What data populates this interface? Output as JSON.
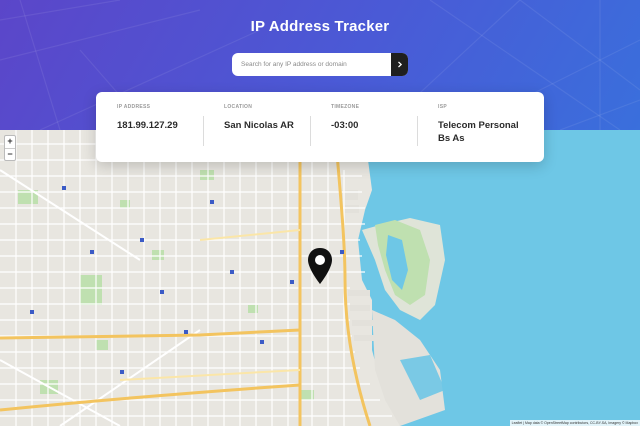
{
  "app": {
    "title": "IP Address Tracker"
  },
  "search": {
    "placeholder": "Search for any IP address or domain",
    "value": "",
    "button_icon": "chevron-right-icon"
  },
  "info": {
    "ip_label": "IP ADDRESS",
    "ip_value": "181.99.127.29",
    "location_label": "LOCATION",
    "location_value": "San Nicolas AR",
    "timezone_label": "TIMEZONE",
    "timezone_value": "-03:00",
    "isp_label": "ISP",
    "isp_value": "Telecom Personal Bs As"
  },
  "map": {
    "zoom_in": "+",
    "zoom_out": "−",
    "marker_icon": "location-pin-icon",
    "attribution": "Leaflet | Map data © OpenStreetMap contributors, CC-BY-SA, Imagery © Mapbox"
  },
  "colors": {
    "hero_start": "#5b46c9",
    "hero_end": "#3a6fdc",
    "water": "#6ec7e6",
    "land": "#e8e6e0",
    "park": "#bfe0b0",
    "road_major": "#f3c45f"
  }
}
